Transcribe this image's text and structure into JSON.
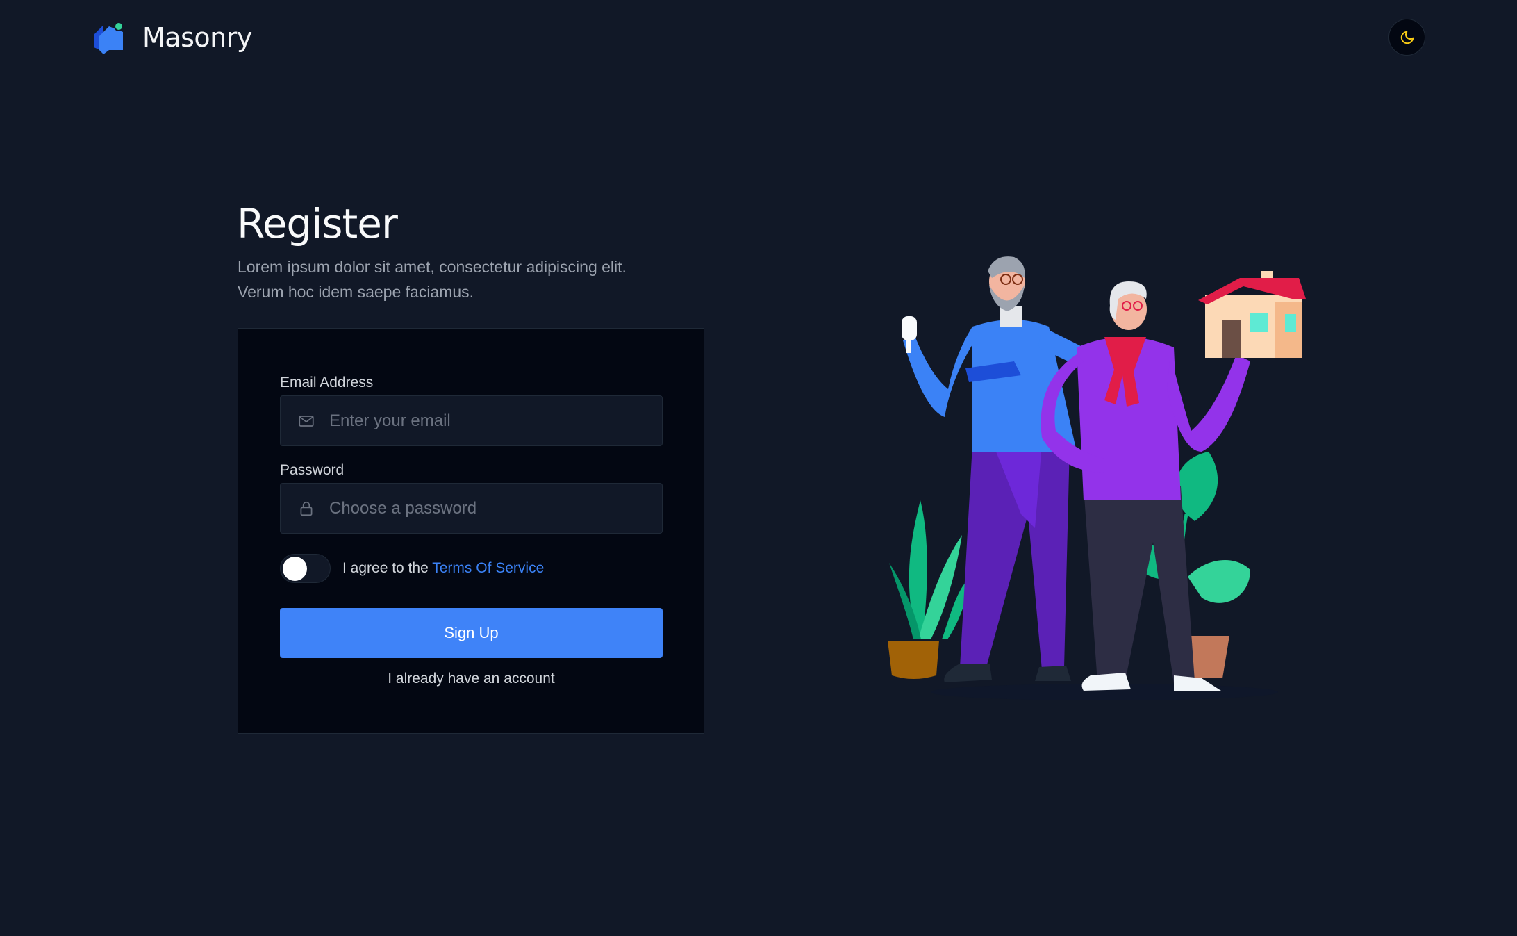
{
  "header": {
    "brand_name": "Masonry",
    "theme_icon": "moon-icon"
  },
  "intro": {
    "title": "Register",
    "subtitle_line1": "Lorem ipsum dolor sit amet, consectetur adipiscing elit.",
    "subtitle_line2": "Verum hoc idem saepe faciamus."
  },
  "form": {
    "email": {
      "label": "Email Address",
      "placeholder": "Enter your email",
      "value": "",
      "icon": "envelope-icon"
    },
    "password": {
      "label": "Password",
      "placeholder": "Choose a password",
      "value": "",
      "icon": "lock-icon"
    },
    "terms": {
      "checked": false,
      "prefix": "I agree to the",
      "link_text": "Terms Of Service"
    },
    "submit_label": "Sign Up",
    "login_link": "I already have an account"
  },
  "colors": {
    "background": "#111827",
    "card": "#030712",
    "accent": "#3f83f8",
    "link": "#3b82f6",
    "moon": "#facc15"
  }
}
